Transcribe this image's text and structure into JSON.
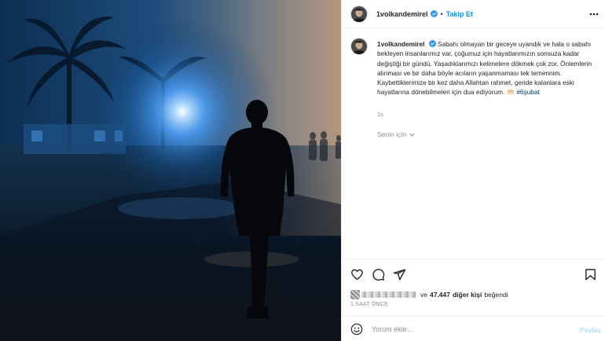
{
  "post": {
    "username": "1volkandemirel",
    "verified": true,
    "dot": "•",
    "follow_label": "Takip Et",
    "more_icon": "more-horizontal-icon",
    "caption": {
      "username": "1volkandemirel",
      "text": "Sabahı olmayan bir geceye uyandık ve hala o sabahı bekleyen insanlarımız var, çoğumuz için hayatlarımızın sonsuza kadar değiştiği bir gündü. Yaşadıklarımızı kelimelere dökmek çok zor. Önlemlerin alınması ve bir daha böyle acıların yaşanmaması tek temennim. Kaybettiklerimize bir kez daha Allahtan rahmet, geride kalanlara eski hayatlarına dönebilmeleri için dua ediyorum.",
      "emoji": "🤲🏻",
      "hashtag": "#6şubat",
      "time": "1s"
    },
    "translate_label": "Senin için",
    "likes": {
      "prefix": "ve",
      "count": "47.447",
      "suffix_bold": "diğer kişi",
      "suffix": "beğendi"
    },
    "time_ago": "1 saat önce",
    "comment": {
      "placeholder": "Yorum ekle...",
      "post_label": "Paylaş"
    },
    "colors": {
      "accent": "#0095f6",
      "hashtag": "#00376b",
      "muted": "#8e8e8e",
      "verified": "#3897f0"
    },
    "icons": [
      "heart-icon",
      "comment-icon",
      "share-icon",
      "bookmark-icon",
      "emoji-icon",
      "chevron-down-icon",
      "verified-badge-icon"
    ]
  }
}
